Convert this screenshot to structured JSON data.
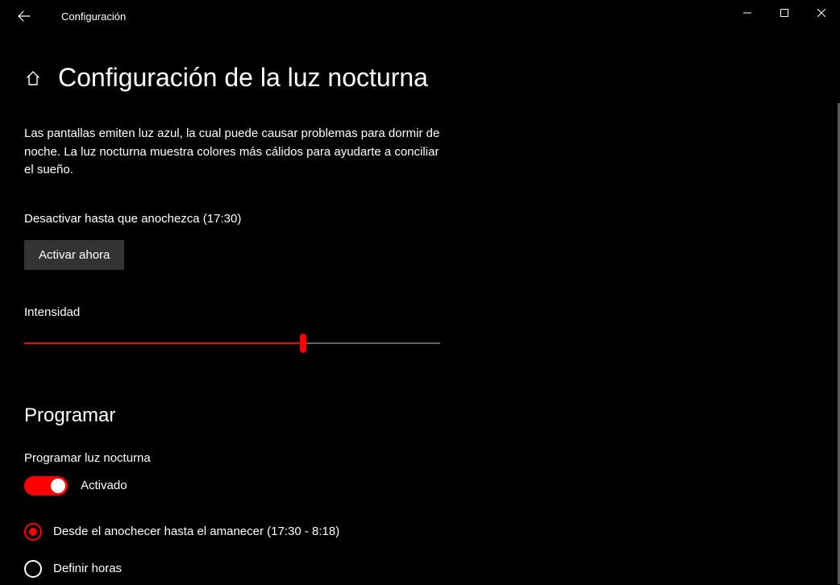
{
  "window": {
    "title": "Configuración"
  },
  "page": {
    "title": "Configuración de la luz nocturna",
    "description": "Las pantallas emiten luz azul, la cual puede causar problemas para dormir de noche. La luz nocturna muestra colores más cálidos para ayudarte a conciliar el sueño.",
    "status_line": "Desactivar hasta que anochezca (17:30)",
    "action_button": "Activar ahora"
  },
  "intensity": {
    "label": "Intensidad",
    "percent": 67
  },
  "schedule": {
    "heading": "Programar",
    "toggle_label": "Programar luz nocturna",
    "toggle_on": true,
    "toggle_state_text": "Activado",
    "options": [
      {
        "label": "Desde el anochecer hasta el amanecer (17:30 - 8:18)",
        "selected": true
      },
      {
        "label": "Definir horas",
        "selected": false
      }
    ]
  },
  "colors": {
    "accent": "#ff0000"
  }
}
